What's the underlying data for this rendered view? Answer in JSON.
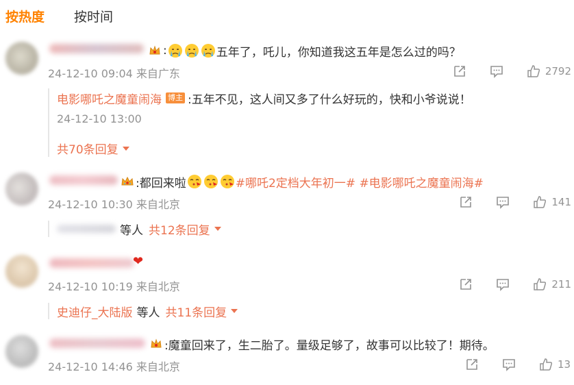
{
  "tabs": {
    "hot": "按热度",
    "time": "按时间"
  },
  "colors": {
    "accent": "#ff8200",
    "link": "#eb7350",
    "meta": "#939393",
    "text": "#333333"
  },
  "comments": [
    {
      "emojis": [
        "crying-face-emoji",
        "crying-face-emoji",
        "crying-face-emoji"
      ],
      "text": "五年了，吒儿，你知道我这五年是怎么过的吗？",
      "meta": "24-12-10 09:04 来自广东",
      "likes": "2792",
      "reply": {
        "author": "电影哪吒之魔童闹海",
        "badge": "博主",
        "text": ":五年不见，这人间又多了什么好玩的，快和小爷说说！",
        "meta": "24-12-10 13:00",
        "more": "共70条回复"
      }
    },
    {
      "text_prefix": ":都回来啦",
      "emojis": [
        "kissing-face-emoji",
        "kissing-face-emoji",
        "kissing-face-emoji"
      ],
      "tags": "#哪吒2定档大年初一# #电影哪吒之魔童闹海#",
      "meta": "24-12-10 10:30 来自北京",
      "likes": "141",
      "sub_suffix": "等人",
      "more": "共12条回复"
    },
    {
      "meta": "24-12-10 10:19 来自北京",
      "likes": "211",
      "sub_name": "史迪仔_大陆版",
      "sub_suffix": "等人",
      "more": "共11条回复"
    },
    {
      "text": ":魔童回来了，生二胎了。量级足够了，故事可以比较了！期待。",
      "meta": "24-12-10 14:46 来自北京",
      "likes": "13"
    }
  ]
}
